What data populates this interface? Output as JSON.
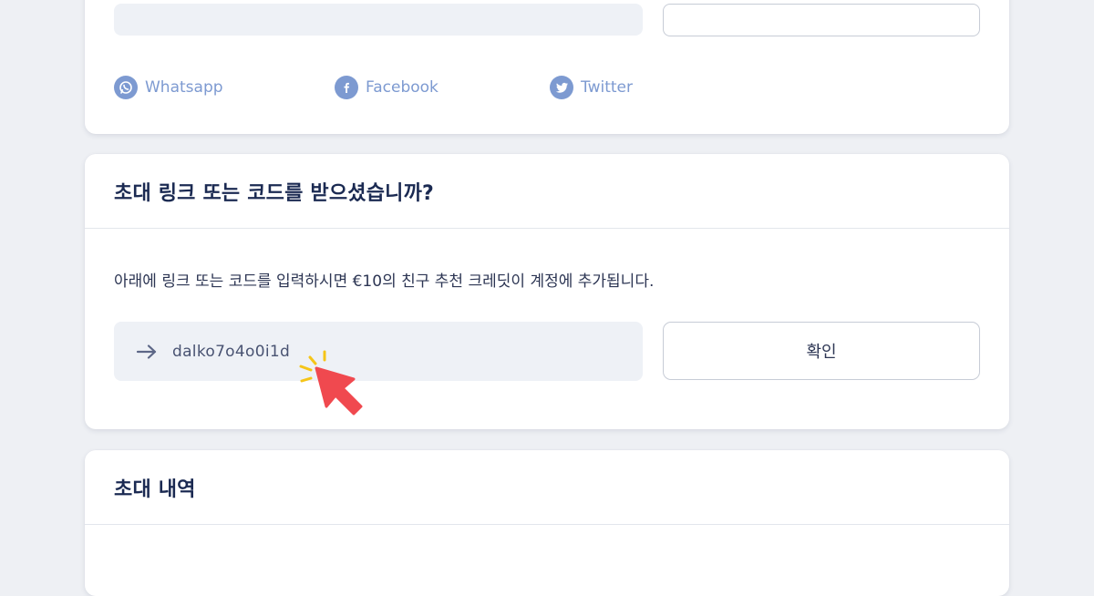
{
  "share": {
    "social": [
      {
        "label": "Whatsapp",
        "icon": "whatsapp-icon"
      },
      {
        "label": "Facebook",
        "icon": "facebook-icon"
      },
      {
        "label": "Twitter",
        "icon": "twitter-icon"
      }
    ]
  },
  "invite": {
    "title": "초대 링크 또는 코드를 받으셨습니까?",
    "description": "아래에 링크 또는 코드를 입력하시면 €10의 친구 추천 크레딧이 계정에 추가됩니다.",
    "code_value": "dalko7o4o0i1d",
    "confirm_label": "확인"
  },
  "history": {
    "title": "초대 내역"
  },
  "colors": {
    "title": "#1b2a52",
    "social": "#7d9ad1",
    "field_bg": "#eef1f6",
    "cursor": "#f0494f",
    "sparkle": "#f5c518"
  }
}
